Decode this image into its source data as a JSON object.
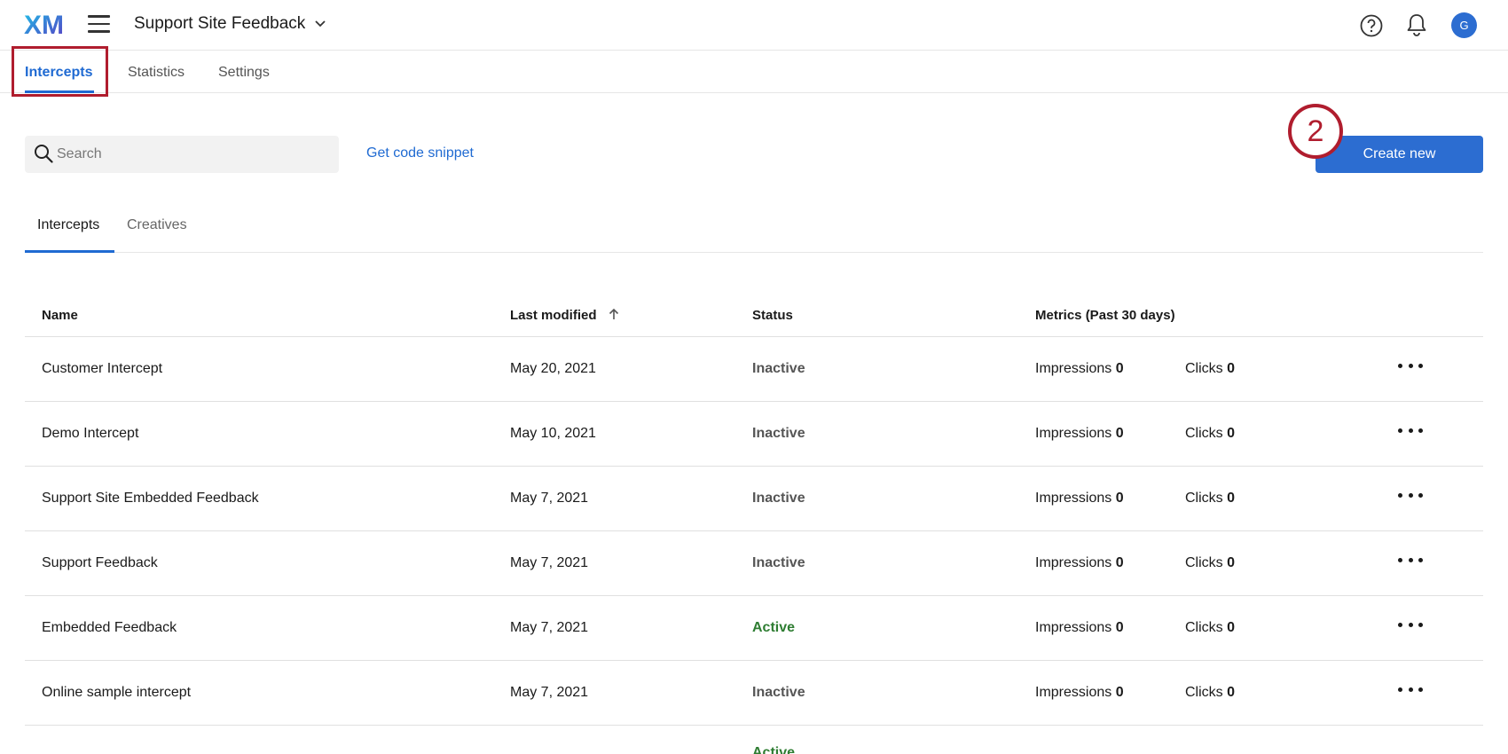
{
  "app": {
    "logo_text": "XM",
    "project_name": "Support Site Feedback",
    "avatar_initial": "G"
  },
  "main_tabs": [
    {
      "label": "Intercepts",
      "active": true
    },
    {
      "label": "Statistics",
      "active": false
    },
    {
      "label": "Settings",
      "active": false
    }
  ],
  "toolbar": {
    "search_placeholder": "Search",
    "snippet_link": "Get code snippet",
    "create_label": "Create new",
    "step_number": "2"
  },
  "sub_tabs": [
    {
      "label": "Intercepts",
      "active": true
    },
    {
      "label": "Creatives",
      "active": false
    }
  ],
  "table": {
    "headers": {
      "name": "Name",
      "last_modified": "Last modified",
      "status": "Status",
      "metrics": "Metrics (Past 30 days)"
    },
    "impressions_label": "Impressions",
    "clicks_label": "Clicks",
    "rows": [
      {
        "name": "Customer Intercept",
        "date": "May 20, 2021",
        "status": "Inactive",
        "impressions": "0",
        "clicks": "0"
      },
      {
        "name": "Demo Intercept",
        "date": "May 10, 2021",
        "status": "Inactive",
        "impressions": "0",
        "clicks": "0"
      },
      {
        "name": "Support Site Embedded Feedback",
        "date": "May 7, 2021",
        "status": "Inactive",
        "impressions": "0",
        "clicks": "0"
      },
      {
        "name": "Support Feedback",
        "date": "May 7, 2021",
        "status": "Inactive",
        "impressions": "0",
        "clicks": "0"
      },
      {
        "name": "Embedded Feedback",
        "date": "May 7, 2021",
        "status": "Active",
        "impressions": "0",
        "clicks": "0"
      },
      {
        "name": "Online sample intercept",
        "date": "May 7, 2021",
        "status": "Inactive",
        "impressions": "0",
        "clicks": "0"
      },
      {
        "name": "",
        "date": "",
        "status": "Active",
        "impressions": "",
        "clicks": ""
      }
    ]
  },
  "colors": {
    "accent": "#1f6ad2",
    "button": "#2c6dd1",
    "highlight": "#b01d2e",
    "active_status": "#2e7d32",
    "inactive_status": "#555555"
  }
}
